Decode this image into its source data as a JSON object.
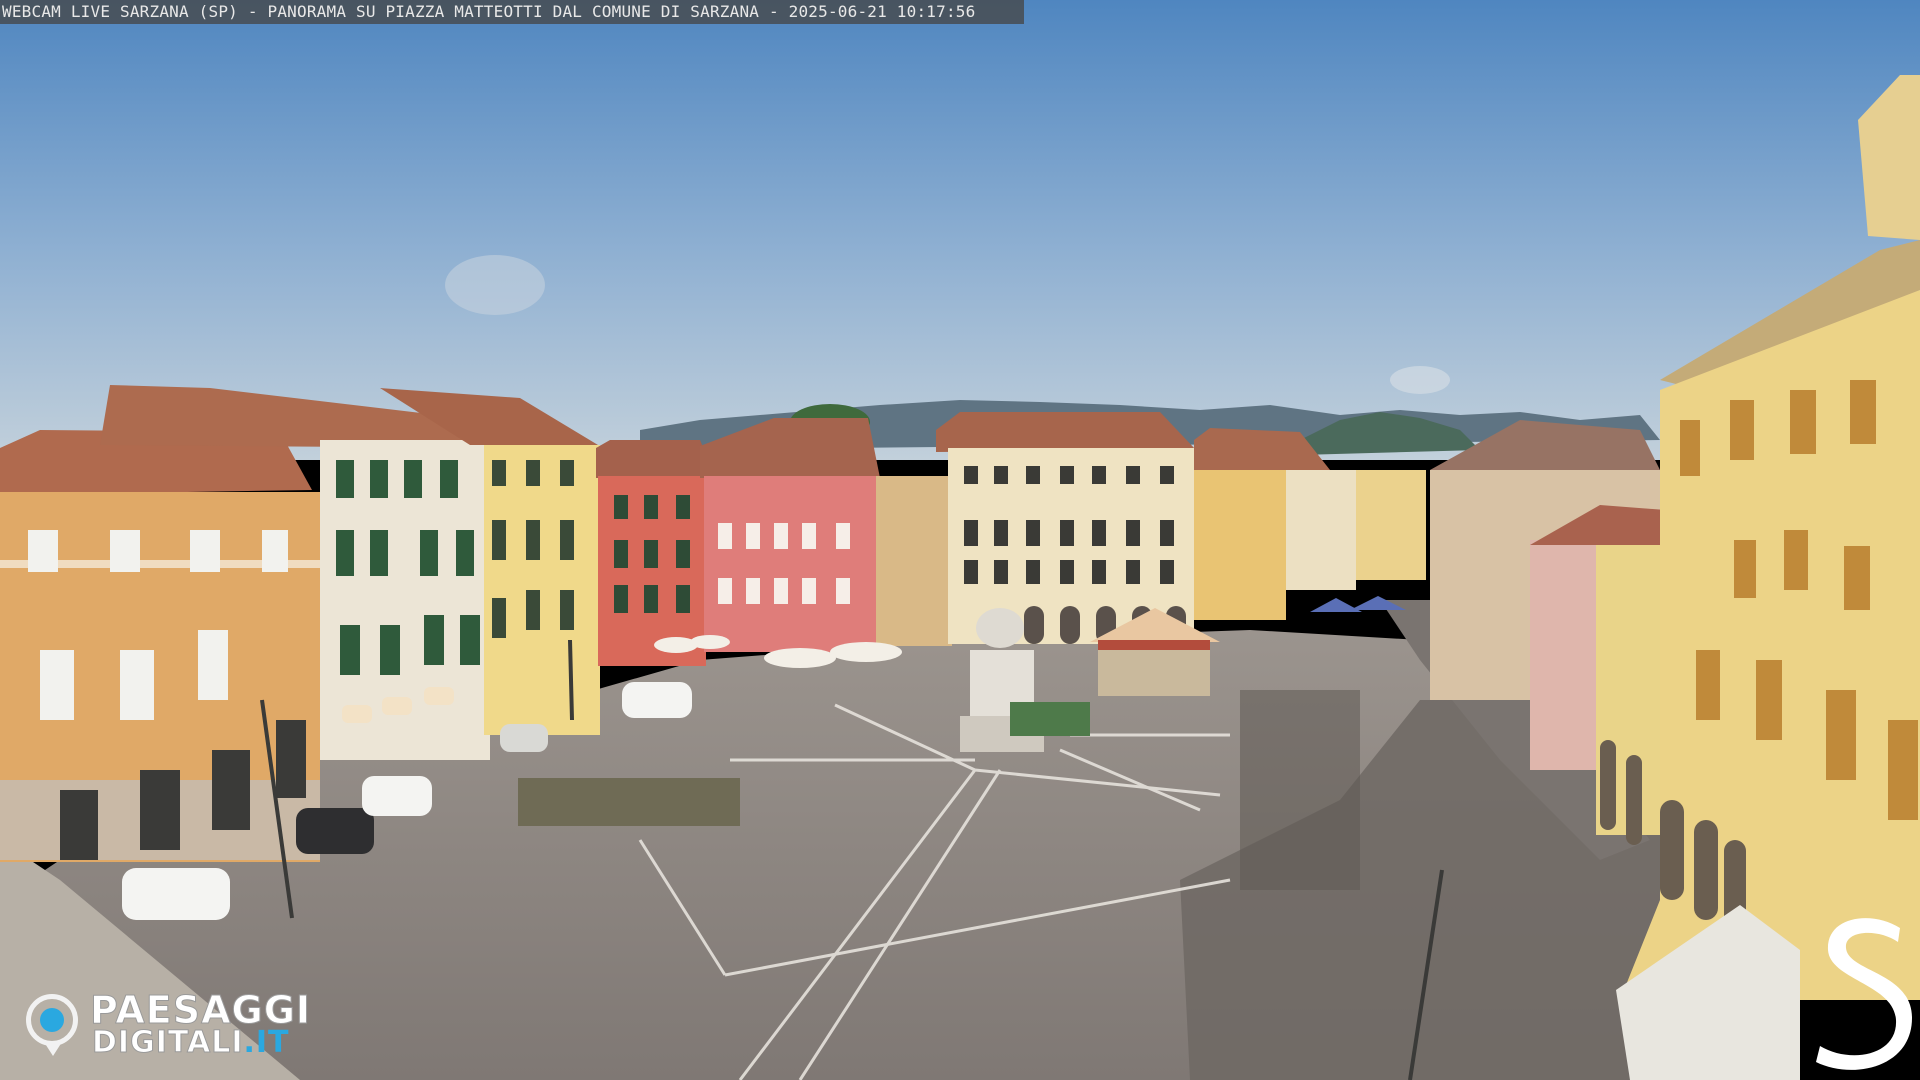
{
  "overlay": {
    "caption": "WEBCAM LIVE SARZANA (SP) - PANORAMA SU PIAZZA MATTEOTTI DAL COMUNE DI SARZANA - 2025-06-21  10:17:56",
    "logo_line1": "PAESAGGI",
    "logo_line2_main": "DIGITALI",
    "logo_line2_tld": ".IT",
    "corner_logo_letter": "S"
  },
  "colors": {
    "sky_top": "#5b8ec4",
    "sky_bottom": "#b8c9d8",
    "pavement": "#8d8580",
    "brand_blue": "#2aa8e0"
  }
}
